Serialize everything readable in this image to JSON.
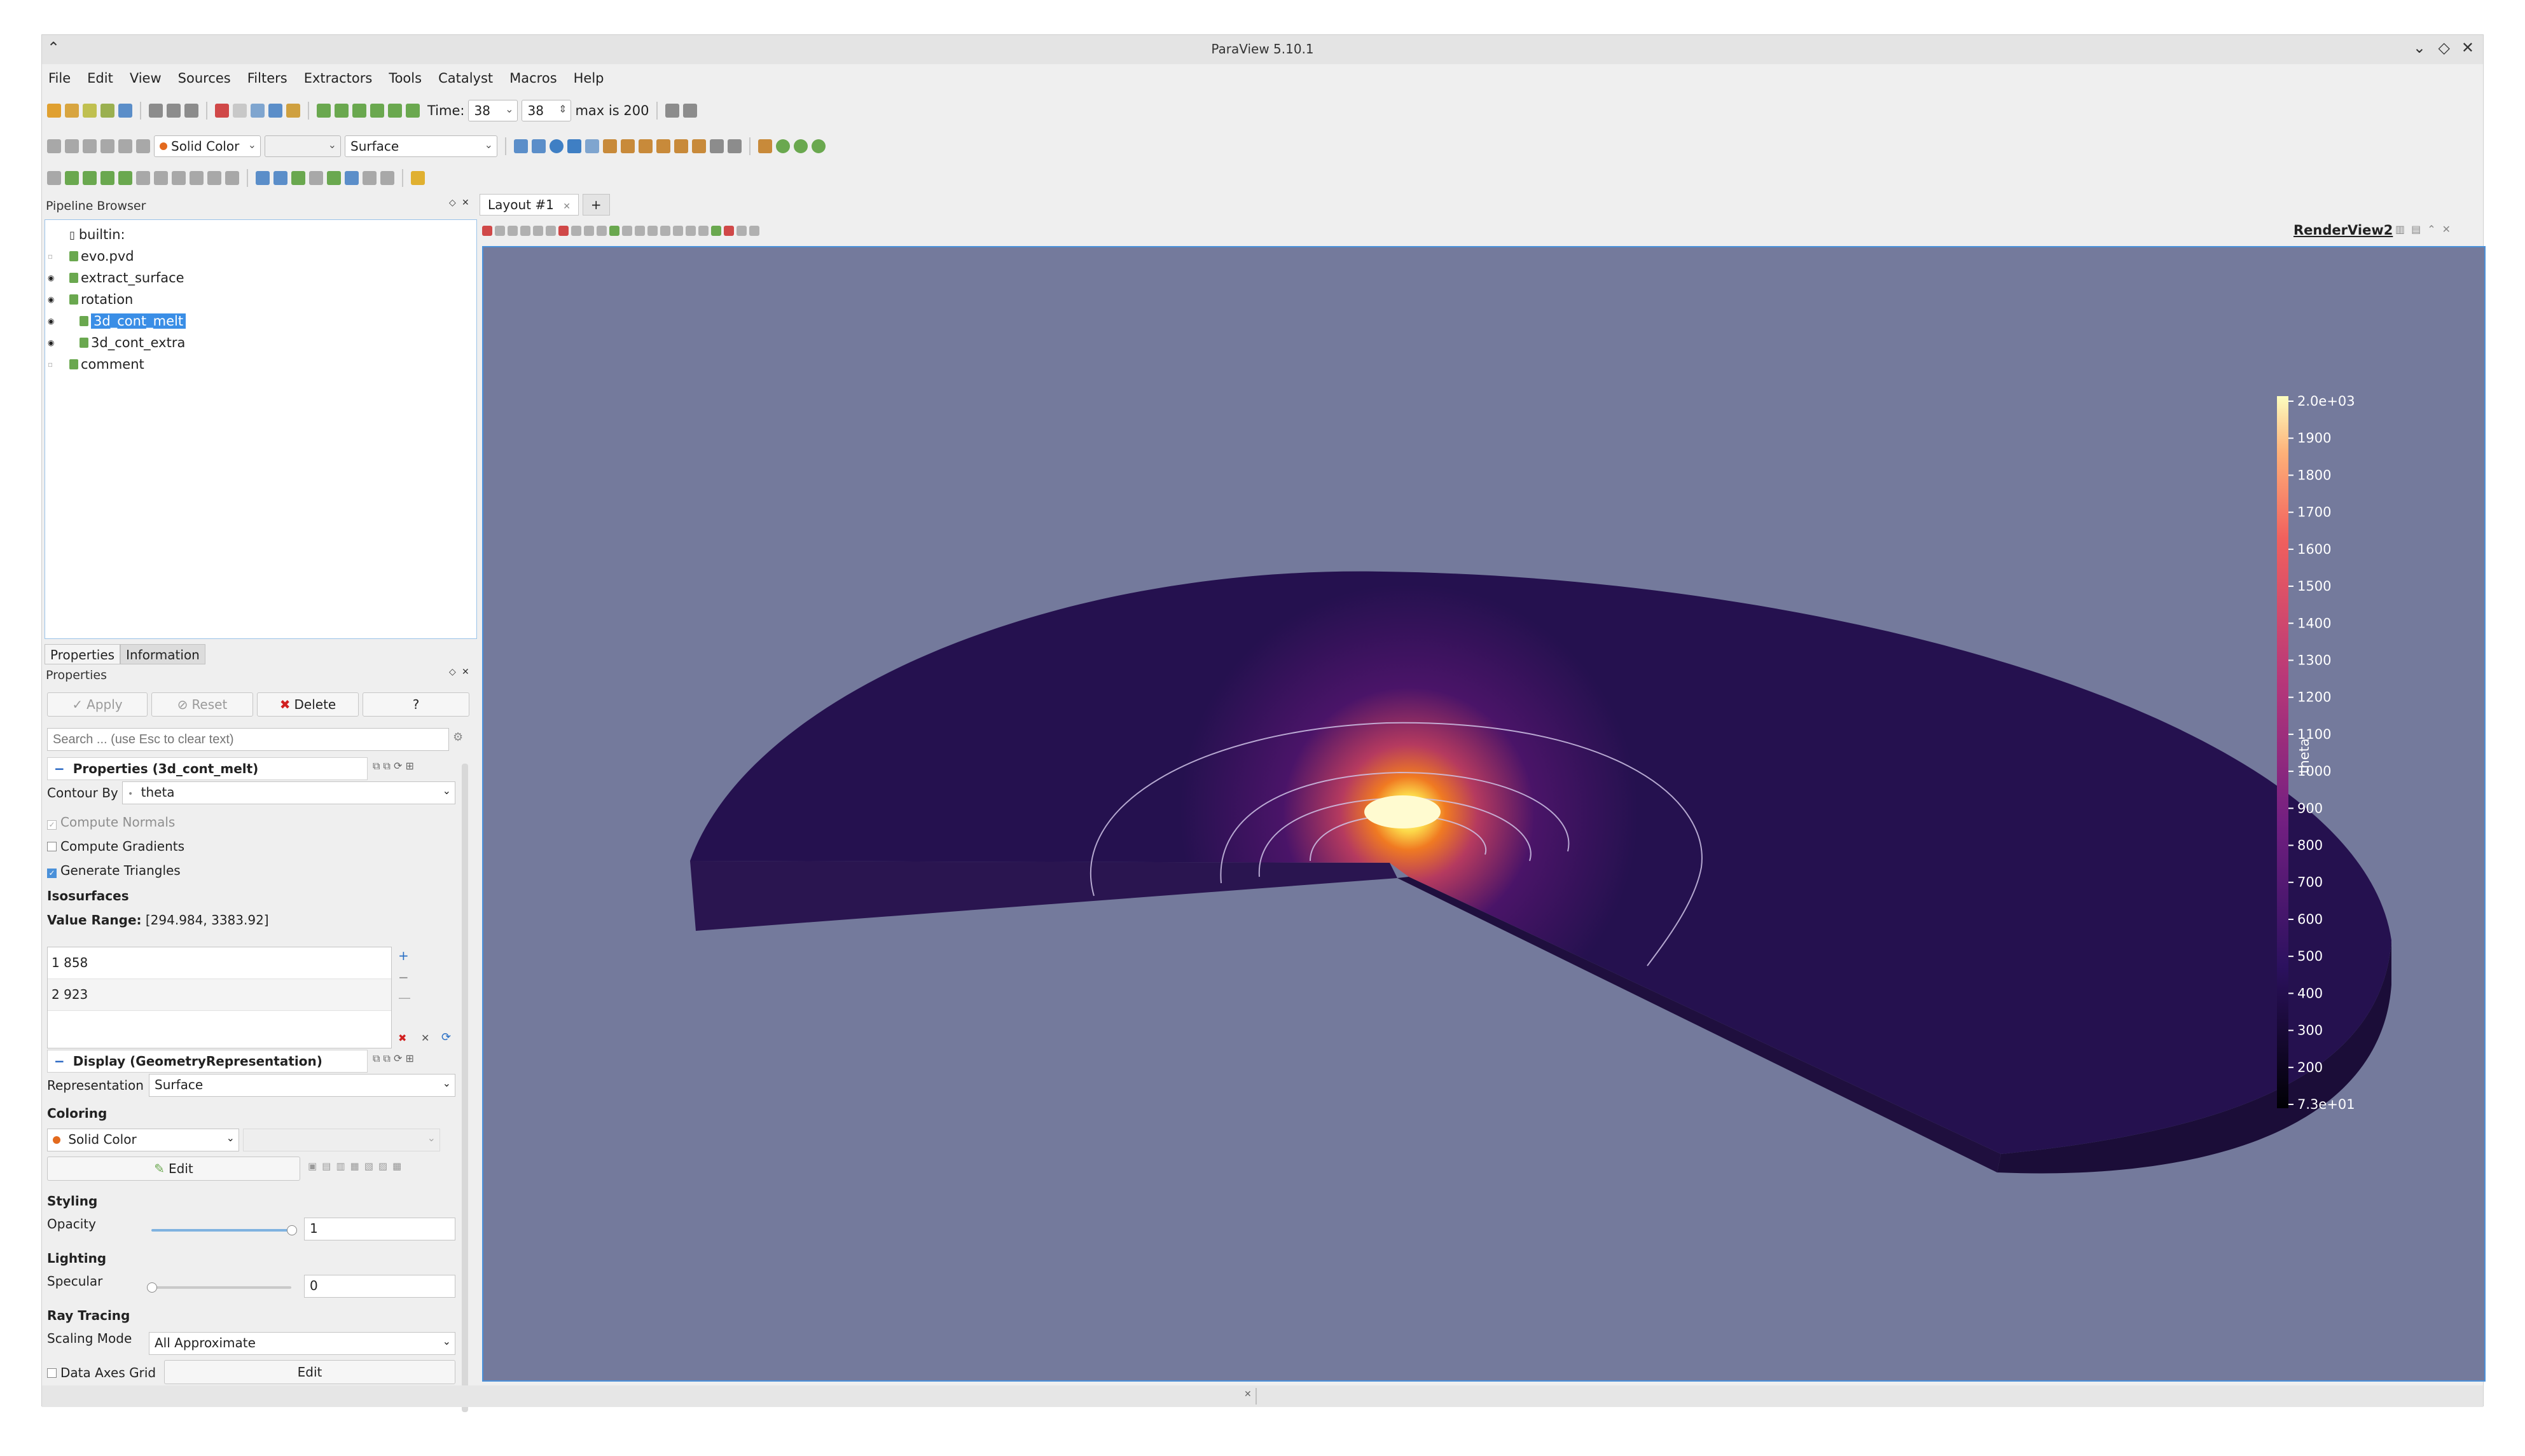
{
  "window": {
    "title": "ParaView 5.10.1"
  },
  "menu": [
    "File",
    "Edit",
    "View",
    "Sources",
    "Filters",
    "Extractors",
    "Tools",
    "Catalyst",
    "Macros",
    "Help"
  ],
  "toolbar": {
    "time_label": "Time:",
    "time_value": "38",
    "time_index": "38",
    "time_max": "max is 200",
    "color_by": "Solid Color",
    "representation": "Surface"
  },
  "pipeline": {
    "title": "Pipeline Browser",
    "items": [
      {
        "label": "builtin:"
      },
      {
        "label": "evo.pvd"
      },
      {
        "label": "extract_surface"
      },
      {
        "label": "rotation"
      },
      {
        "label": "3d_cont_melt"
      },
      {
        "label": "3d_cont_extra"
      },
      {
        "label": "comment"
      }
    ]
  },
  "tabs": {
    "properties": "Properties",
    "information": "Information"
  },
  "properties": {
    "title": "Properties",
    "apply": "Apply",
    "reset": "Reset",
    "delete": "Delete",
    "help": "?",
    "search_placeholder": "Search ... (use Esc to clear text)",
    "section_title": "Properties (3d_cont_melt)",
    "contour_by_label": "Contour By",
    "contour_by_value": "theta",
    "compute_normals": "Compute Normals",
    "compute_gradients": "Compute Gradients",
    "generate_triangles": "Generate Triangles",
    "isosurfaces": "Isosurfaces",
    "value_range_label": "Value Range:",
    "value_range": "[294.984, 3383.92]",
    "iso_values": [
      {
        "index": "1",
        "value": "858"
      },
      {
        "index": "2",
        "value": "923"
      }
    ]
  },
  "display": {
    "section_title": "Display (GeometryRepresentation)",
    "representation_label": "Representation",
    "representation_value": "Surface",
    "coloring": "Coloring",
    "coloring_value": "Solid Color",
    "edit": "Edit",
    "styling": "Styling",
    "opacity_label": "Opacity",
    "opacity_value": "1",
    "opacity_level": 1.0,
    "lighting": "Lighting",
    "specular_label": "Specular",
    "specular_value": "0",
    "specular_level": 0.0,
    "ray_tracing": "Ray Tracing",
    "scaling_mode_label": "Scaling Mode",
    "scaling_mode_value": "All Approximate",
    "data_axes_grid": "Data Axes Grid",
    "data_axes_edit": "Edit"
  },
  "layout": {
    "tab": "Layout #1",
    "add": "+",
    "view_name": "RenderView2"
  },
  "colorbar": {
    "title": "theta",
    "labels": [
      "2.0e+03",
      "1900",
      "1800",
      "1700",
      "1600",
      "1500",
      "1400",
      "1300",
      "1200",
      "1100",
      "1000",
      "900",
      "800",
      "700",
      "600",
      "500",
      "400",
      "300",
      "200",
      "7.3e+01"
    ],
    "colors": {
      "max": "#fcfdbf",
      "mid": "#e85a2c",
      "low": "#6a1c81",
      "min": "#000004"
    }
  },
  "colors": {
    "accent": "#4a90d9",
    "background": "#747a9c",
    "selection": "#3a8ee6"
  }
}
